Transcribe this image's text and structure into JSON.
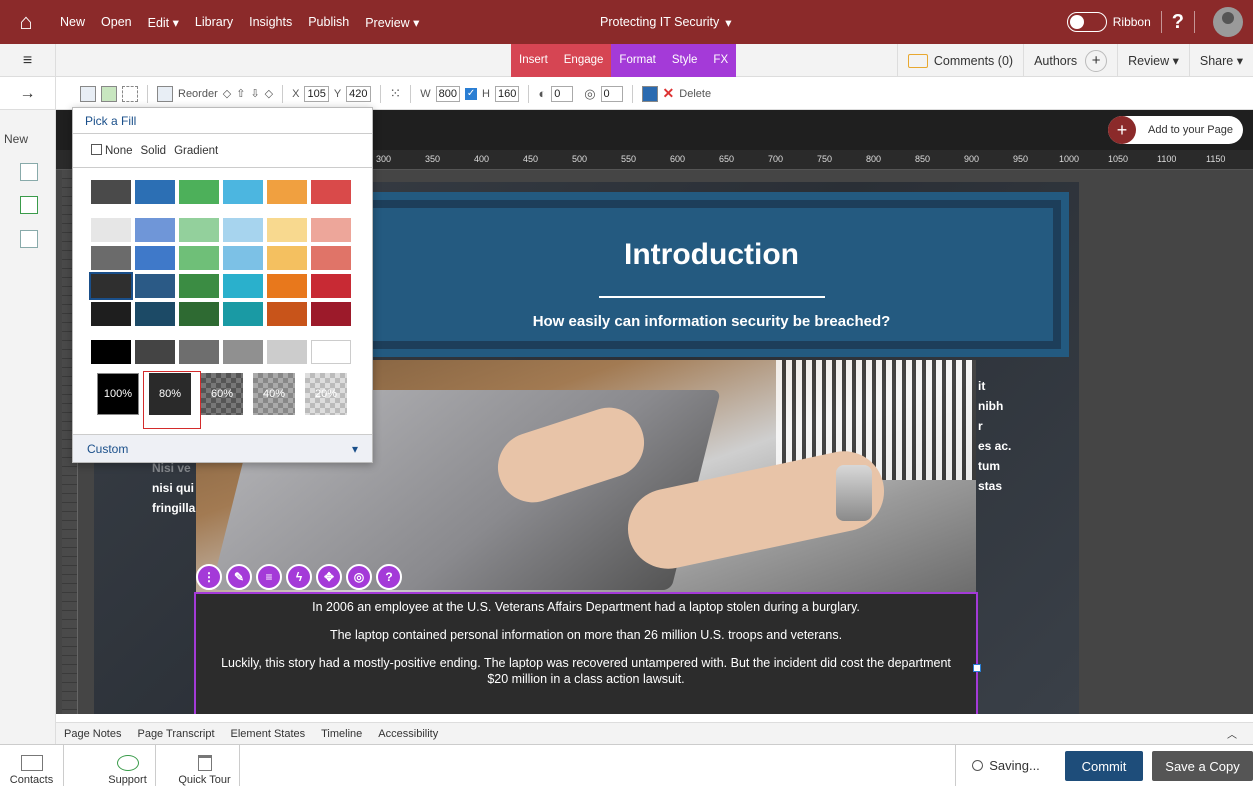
{
  "topbar": {
    "menu": [
      "New",
      "Open",
      "Edit ▾",
      "Library",
      "Insights",
      "Publish",
      "Preview ▾"
    ],
    "doc_title": "Protecting IT Security",
    "ribbon_label": "Ribbon",
    "help": "?"
  },
  "tabs": {
    "insert": "Insert",
    "engage": "Engage",
    "format": "Format",
    "style": "Style",
    "fx": "FX"
  },
  "right_bar": {
    "comments": "Comments (0)",
    "authors": "Authors",
    "review": "Review ▾",
    "share": "Share ▾"
  },
  "format_toolbar": {
    "reorder": "Reorder",
    "x_label": "X",
    "x_value": "105",
    "y_label": "Y",
    "y_value": "420",
    "w_label": "W",
    "w_value": "800",
    "h_label": "H",
    "h_value": "160",
    "opacity_value": "0",
    "rotate_value": "0",
    "delete": "Delete"
  },
  "leftbar": {
    "new_label": "New"
  },
  "canvas": {
    "add_to_page": "Add to your Page",
    "ruler_ticks": [
      "300",
      "350",
      "400",
      "450",
      "500",
      "550",
      "600",
      "650",
      "700",
      "750",
      "800",
      "850",
      "900",
      "950",
      "1000",
      "1050",
      "1100",
      "1150"
    ]
  },
  "slide": {
    "title": "Introduction",
    "subtitle": "How easily can information security be breached?",
    "left_text": [
      "Nisi ve",
      "nisi qui",
      "fringilla"
    ],
    "right_text": [
      "it",
      "nibh",
      "r",
      "es ac.",
      "tum",
      "stas"
    ],
    "paragraphs": [
      "In 2006 an employee at the U.S. Veterans Affairs Department had a laptop stolen during a burglary.",
      "The laptop contained personal information on more than 26 million U.S. troops and veterans.",
      "Luckily, this story had a mostly-positive ending. The laptop was recovered untampered with. But the incident did cost the department $20 million in a class action lawsuit."
    ]
  },
  "fill_popup": {
    "title": "Pick a Fill",
    "none": "None",
    "solid": "Solid",
    "gradient": "Gradient",
    "row1": [
      "#4a4a4a",
      "#2c6fb4",
      "#4db05a",
      "#4cb6e0",
      "#f0a040",
      "#d94a4a"
    ],
    "row2": [
      "#e6e6e6",
      "#6f96d8",
      "#93d09c",
      "#a7d4ee",
      "#f8d98f",
      "#eda69a"
    ],
    "row3": [
      "#6b6b6b",
      "#3f79c9",
      "#6fbf78",
      "#7cc1e6",
      "#f4c060",
      "#e07468"
    ],
    "row4": [
      "#2f2f2f",
      "#2b5a86",
      "#3b8c43",
      "#2ab0cc",
      "#e8781c",
      "#c82a34"
    ],
    "row5": [
      "#1e1e1e",
      "#1c4a66",
      "#2e6a32",
      "#1a9aa4",
      "#c8541a",
      "#9c1a2a"
    ],
    "gray_row": [
      "#000000",
      "#444444",
      "#6e6e6e",
      "#909090",
      "#cccccc",
      "#ffffff"
    ],
    "opacities": [
      "100%",
      "80%",
      "60%",
      "40%",
      "20%"
    ],
    "custom": "Custom"
  },
  "bottom_tabs": [
    "Page Notes",
    "Page Transcript",
    "Element States",
    "Timeline",
    "Accessibility"
  ],
  "footer": {
    "contacts": "Contacts",
    "support": "Support",
    "quick_tour": "Quick Tour",
    "saving": "Saving...",
    "commit": "Commit",
    "save_copy": "Save a Copy"
  }
}
